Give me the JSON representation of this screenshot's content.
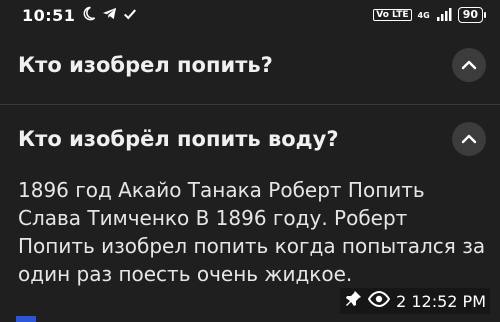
{
  "status_bar": {
    "time": "10:51",
    "network_badge": "Vo LTE",
    "network_type": "4G",
    "battery": "90"
  },
  "questions": [
    {
      "title": "Кто изобрел попить?",
      "expanded": false
    },
    {
      "title": "Кто изобрёл попить воду?",
      "expanded": true,
      "answer": "1896 год Акайо Танака Роберт Попить Слава Тимченко В 1896 году. Роберт Попить изобрел попить когда попытался за один раз поесть очень жидкое."
    }
  ],
  "overlay": {
    "timestamp": "2 12:52 PM"
  },
  "colors": {
    "background": "#1f1f1f",
    "chevron_bg": "#3c3c3c",
    "accent": "#2a55d8"
  }
}
